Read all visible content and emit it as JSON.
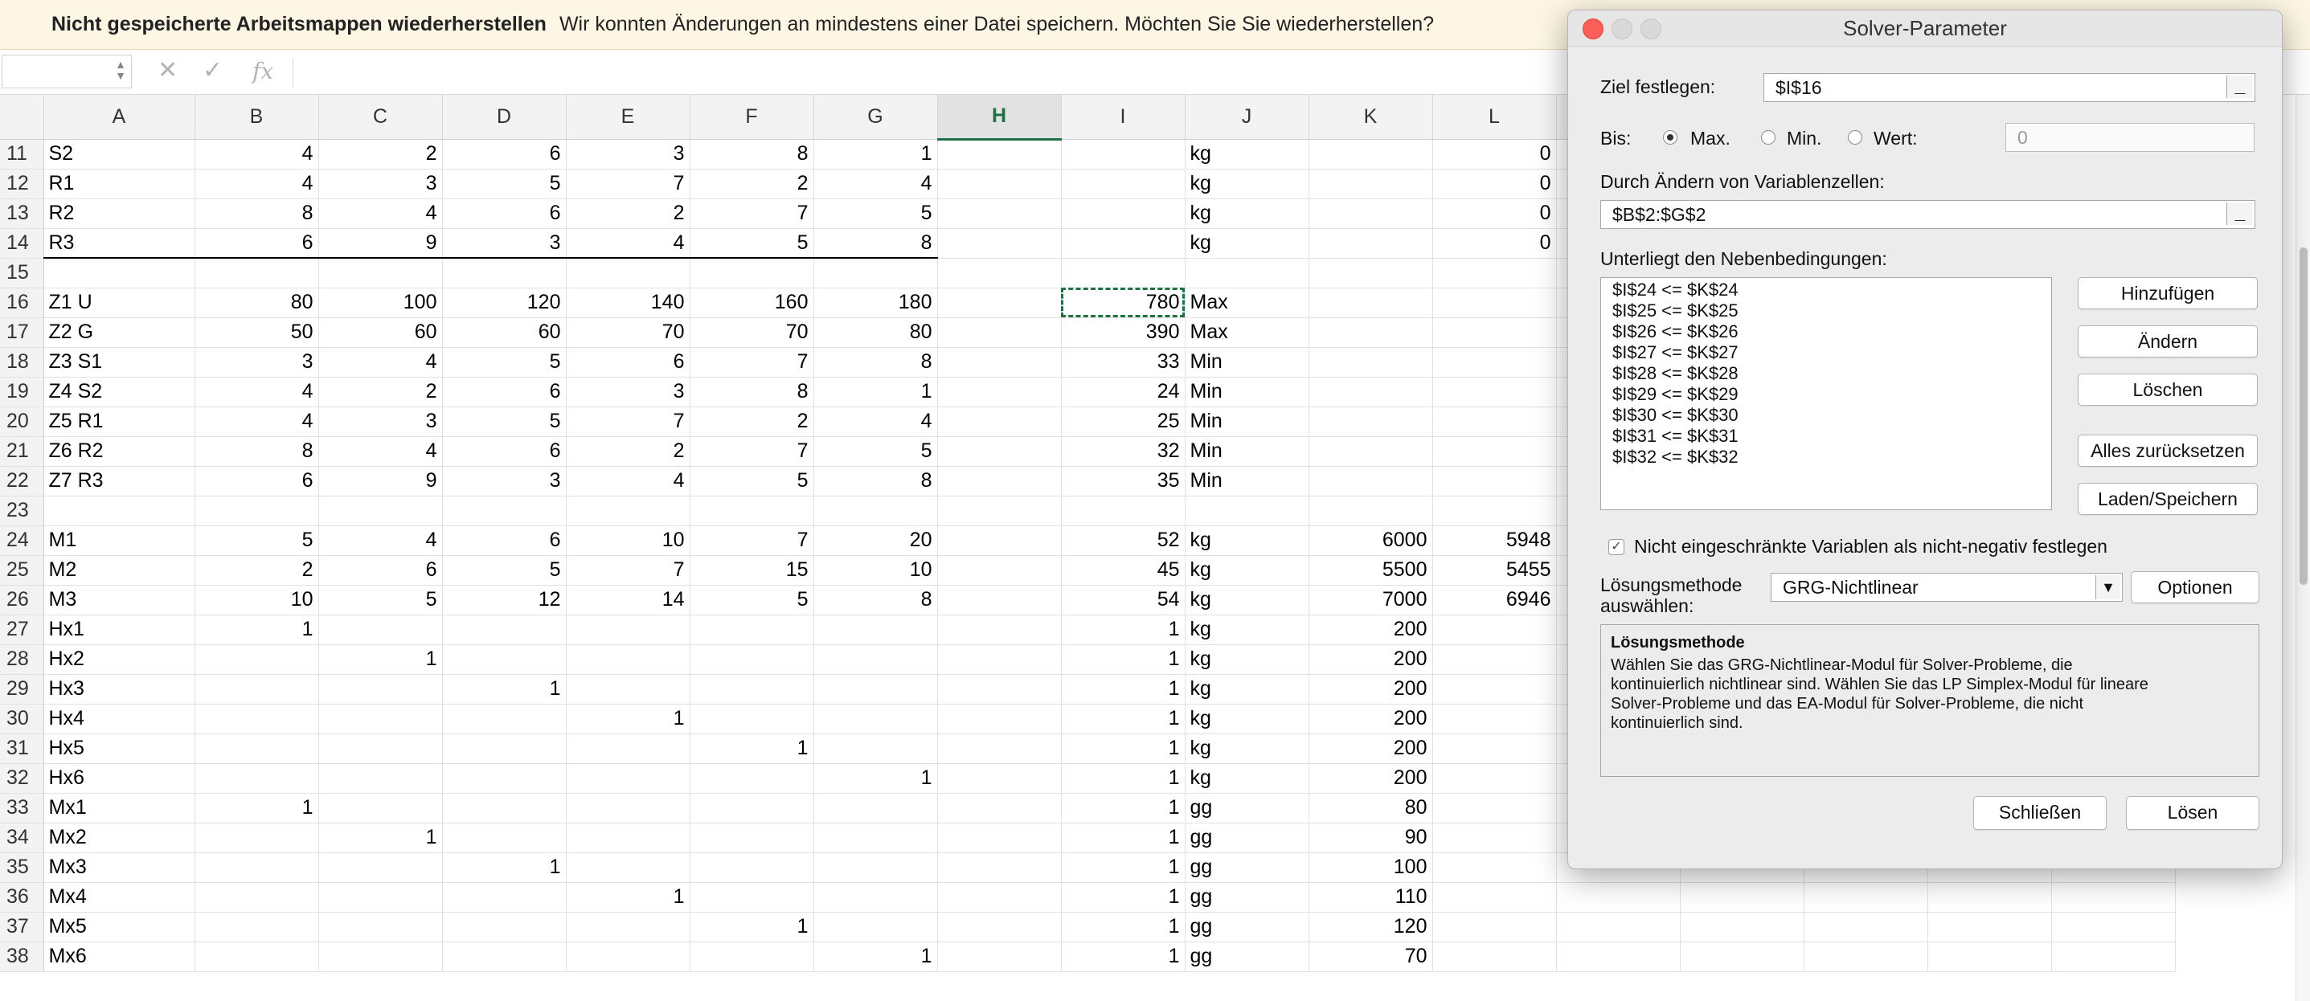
{
  "notification": {
    "title": "Nicht gespeicherte Arbeitsmappen wiederherstellen",
    "message": "Wir konnten Änderungen an mindestens einer Datei speichern. Möchten Sie Sie wiederherstellen?"
  },
  "formula_bar": {
    "name_box": "",
    "cancel_icon": "✕",
    "enter_icon": "✓",
    "fx_label": "fx",
    "content": ""
  },
  "sheet": {
    "columns": [
      "A",
      "B",
      "C",
      "D",
      "E",
      "F",
      "G",
      "H",
      "I",
      "J",
      "K",
      "L"
    ],
    "active_column": "H",
    "selected_cell": "I16",
    "rows": [
      {
        "n": "11",
        "cells": [
          "S2",
          "4",
          "2",
          "6",
          "3",
          "8",
          "1",
          "",
          "",
          "kg",
          "",
          "0"
        ]
      },
      {
        "n": "12",
        "cells": [
          "R1",
          "4",
          "3",
          "5",
          "7",
          "2",
          "4",
          "",
          "",
          "kg",
          "",
          "0"
        ]
      },
      {
        "n": "13",
        "cells": [
          "R2",
          "8",
          "4",
          "6",
          "2",
          "7",
          "5",
          "",
          "",
          "kg",
          "",
          "0"
        ]
      },
      {
        "n": "14",
        "cells": [
          "R3",
          "6",
          "9",
          "3",
          "4",
          "5",
          "8",
          "",
          "",
          "kg",
          "",
          "0"
        ]
      },
      {
        "n": "15",
        "cells": [
          "",
          "",
          "",
          "",
          "",
          "",
          "",
          "",
          "",
          "",
          "",
          ""
        ]
      },
      {
        "n": "16",
        "cells": [
          "Z1 U",
          "80",
          "100",
          "120",
          "140",
          "160",
          "180",
          "",
          "780",
          "Max",
          "",
          ""
        ]
      },
      {
        "n": "17",
        "cells": [
          "Z2 G",
          "50",
          "60",
          "60",
          "70",
          "70",
          "80",
          "",
          "390",
          "Max",
          "",
          ""
        ]
      },
      {
        "n": "18",
        "cells": [
          "Z3 S1",
          "3",
          "4",
          "5",
          "6",
          "7",
          "8",
          "",
          "33",
          "Min",
          "",
          ""
        ]
      },
      {
        "n": "19",
        "cells": [
          "Z4 S2",
          "4",
          "2",
          "6",
          "3",
          "8",
          "1",
          "",
          "24",
          "Min",
          "",
          ""
        ]
      },
      {
        "n": "20",
        "cells": [
          "Z5 R1",
          "4",
          "3",
          "5",
          "7",
          "2",
          "4",
          "",
          "25",
          "Min",
          "",
          ""
        ]
      },
      {
        "n": "21",
        "cells": [
          "Z6 R2",
          "8",
          "4",
          "6",
          "2",
          "7",
          "5",
          "",
          "32",
          "Min",
          "",
          ""
        ]
      },
      {
        "n": "22",
        "cells": [
          "Z7 R3",
          "6",
          "9",
          "3",
          "4",
          "5",
          "8",
          "",
          "35",
          "Min",
          "",
          ""
        ]
      },
      {
        "n": "23",
        "cells": [
          "",
          "",
          "",
          "",
          "",
          "",
          "",
          "",
          "",
          "",
          "",
          ""
        ]
      },
      {
        "n": "24",
        "cells": [
          "M1",
          "5",
          "4",
          "6",
          "10",
          "7",
          "20",
          "",
          "52",
          "kg",
          "6000",
          "5948"
        ]
      },
      {
        "n": "25",
        "cells": [
          "M2",
          "2",
          "6",
          "5",
          "7",
          "15",
          "10",
          "",
          "45",
          "kg",
          "5500",
          "5455"
        ]
      },
      {
        "n": "26",
        "cells": [
          "M3",
          "10",
          "5",
          "12",
          "14",
          "5",
          "8",
          "",
          "54",
          "kg",
          "7000",
          "6946"
        ]
      },
      {
        "n": "27",
        "cells": [
          "Hx1",
          "1",
          "",
          "",
          "",
          "",
          "",
          "",
          "1",
          "kg",
          "200",
          ""
        ]
      },
      {
        "n": "28",
        "cells": [
          "Hx2",
          "",
          "1",
          "",
          "",
          "",
          "",
          "",
          "1",
          "kg",
          "200",
          ""
        ]
      },
      {
        "n": "29",
        "cells": [
          "Hx3",
          "",
          "",
          "1",
          "",
          "",
          "",
          "",
          "1",
          "kg",
          "200",
          ""
        ]
      },
      {
        "n": "30",
        "cells": [
          "Hx4",
          "",
          "",
          "",
          "1",
          "",
          "",
          "",
          "1",
          "kg",
          "200",
          ""
        ]
      },
      {
        "n": "31",
        "cells": [
          "Hx5",
          "",
          "",
          "",
          "",
          "1",
          "",
          "",
          "1",
          "kg",
          "200",
          ""
        ]
      },
      {
        "n": "32",
        "cells": [
          "Hx6",
          "",
          "",
          "",
          "",
          "",
          "1",
          "",
          "1",
          "kg",
          "200",
          ""
        ]
      },
      {
        "n": "33",
        "cells": [
          "Mx1",
          "1",
          "",
          "",
          "",
          "",
          "",
          "",
          "1",
          "gg",
          "80",
          ""
        ]
      },
      {
        "n": "34",
        "cells": [
          "Mx2",
          "",
          "1",
          "",
          "",
          "",
          "",
          "",
          "1",
          "gg",
          "90",
          ""
        ]
      },
      {
        "n": "35",
        "cells": [
          "Mx3",
          "",
          "",
          "1",
          "",
          "",
          "",
          "",
          "1",
          "gg",
          "100",
          ""
        ]
      },
      {
        "n": "36",
        "cells": [
          "Mx4",
          "",
          "",
          "",
          "1",
          "",
          "",
          "",
          "1",
          "gg",
          "110",
          ""
        ]
      },
      {
        "n": "37",
        "cells": [
          "Mx5",
          "",
          "",
          "",
          "",
          "1",
          "",
          "",
          "1",
          "gg",
          "120",
          ""
        ]
      },
      {
        "n": "38",
        "cells": [
          "Mx6",
          "",
          "",
          "",
          "",
          "",
          "1",
          "",
          "1",
          "gg",
          "70",
          ""
        ]
      }
    ]
  },
  "solver": {
    "window_title": "Solver-Parameter",
    "objective_label": "Ziel festlegen:",
    "objective_value": "$I$16",
    "to_label": "Bis:",
    "opt_max": "Max.",
    "opt_min": "Min.",
    "opt_value": "Wert:",
    "selected_option": "Max.",
    "value_input": "0",
    "changing_label": "Durch Ändern von Variablenzellen:",
    "changing_value": "$B$2:$G$2",
    "constraints_label": "Unterliegt den Nebenbedingungen:",
    "constraints": [
      "$I$24 <= $K$24",
      "$I$25 <= $K$25",
      "$I$26 <= $K$26",
      "$I$27 <= $K$27",
      "$I$28 <= $K$28",
      "$I$29 <= $K$29",
      "$I$30 <= $K$30",
      "$I$31 <= $K$31",
      "$I$32 <= $K$32"
    ],
    "btn_add": "Hinzufügen",
    "btn_change": "Ändern",
    "btn_delete": "Löschen",
    "btn_reset": "Alles zurücksetzen",
    "btn_load_save": "Laden/Speichern",
    "nonneg_label": "Nicht eingeschränkte Variablen als nicht-negativ festlegen",
    "nonneg_checked": true,
    "method_label_line1": "Lösungsmethode",
    "method_label_line2": "auswählen:",
    "method_value": "GRG-Nichtlinear",
    "btn_options": "Optionen",
    "desc_title": "Lösungsmethode",
    "desc_text_1": "Wählen Sie das GRG-Nichtlinear-Modul für Solver-Probleme, die",
    "desc_text_2": "kontinuierlich nichtlinear sind. Wählen Sie das LP Simplex-Modul für lineare",
    "desc_text_3": "Solver-Probleme und das EA-Modul für Solver-Probleme, die nicht",
    "desc_text_4": "kontinuierlich sind.",
    "btn_close": "Schließen",
    "btn_solve": "Lösen"
  }
}
